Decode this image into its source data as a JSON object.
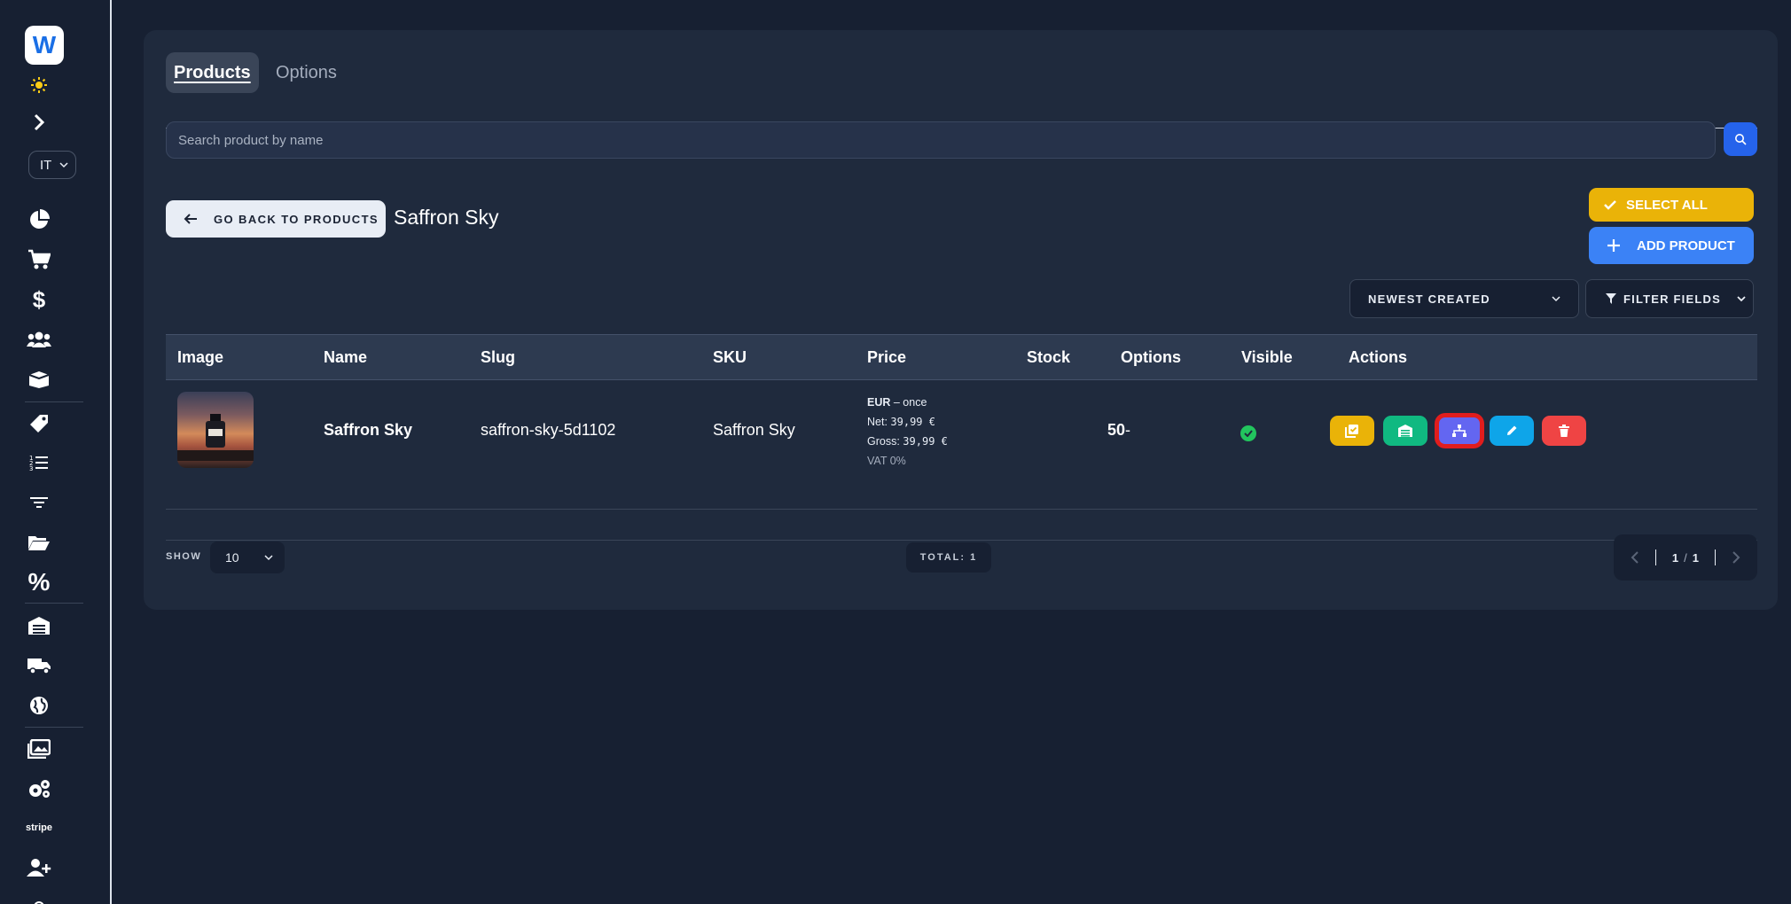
{
  "sidebar": {
    "logo_letter": "W",
    "language": "IT",
    "stripe_label": "stripe",
    "icons": [
      "sun-icon",
      "chevron-right-icon",
      "pie-chart-icon",
      "cart-icon",
      "dollar-icon",
      "users-icon",
      "box-icon",
      "tag-icon",
      "ordered-list-icon",
      "filter-lines-icon",
      "folder-open-icon",
      "percent-icon",
      "warehouse-icon",
      "truck-icon",
      "globe-icon",
      "images-icon",
      "gears-icon",
      "user-plus-icon"
    ]
  },
  "tabs": {
    "products": "Products",
    "options": "Options"
  },
  "search": {
    "placeholder": "Search product by name"
  },
  "header": {
    "back_label": "GO BACK TO PRODUCTS",
    "title": "Saffron Sky",
    "select_all": "SELECT ALL",
    "add_product": "ADD PRODUCT",
    "sort_value": "NEWEST CREATED",
    "filter_label": "FILTER FIELDS"
  },
  "table": {
    "columns": [
      "Image",
      "Name",
      "Slug",
      "SKU",
      "Price",
      "Stock",
      "Options",
      "Visible",
      "Actions"
    ],
    "rows": [
      {
        "name": "Saffron Sky",
        "slug": "saffron-sky-5d1102",
        "sku": "Saffron Sky",
        "price_currency": "EUR",
        "price_mode": " – once",
        "price_net_label": "Net: ",
        "price_net": "39,99 €",
        "price_gross_label": "Gross: ",
        "price_gross": "39,99 €",
        "vat": "VAT 0%",
        "stock": "50",
        "options": "-",
        "visible": true
      }
    ]
  },
  "footer": {
    "show_label": "SHOW",
    "page_size": "10",
    "total": "TOTAL: 1",
    "page_current": "1",
    "page_sep": "/",
    "page_total": "1"
  },
  "colors": {
    "background": "#172032",
    "card": "#1f2a3d",
    "accent_blue": "#3b82f6",
    "accent_yellow": "#eab308",
    "accent_green": "#10b981",
    "accent_purple": "#6366f1",
    "accent_sky": "#0ea5e9",
    "accent_red": "#ef4444",
    "highlight": "#e11d1d"
  }
}
